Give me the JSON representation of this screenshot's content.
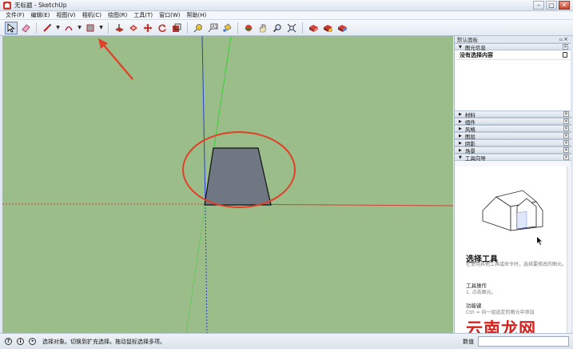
{
  "window": {
    "title": "无标题 - SketchUp",
    "controls": [
      "minimize",
      "maximize",
      "close"
    ]
  },
  "menu": {
    "items": [
      "文件(F)",
      "编辑(E)",
      "视图(V)",
      "相机(C)",
      "绘图(R)",
      "工具(T)",
      "窗口(W)",
      "帮助(H)"
    ]
  },
  "toolbar": {
    "icons": [
      "select-icon",
      "eraser-icon",
      "pencil-line-icon",
      "arc-icon",
      "rectangle-icon",
      "push-pull-icon",
      "offset-icon",
      "move-icon",
      "rotate-icon",
      "scale-icon",
      "tape-measure-icon",
      "text-icon",
      "paint-bucket-icon",
      "orbit-icon",
      "pan-icon",
      "zoom-icon",
      "zoom-extents-icon",
      "warehouse-icon",
      "extension-icon",
      "share-icon"
    ]
  },
  "tray": {
    "title": "默认面板",
    "entity_info": {
      "header": "图元信息",
      "value": "没有选择内容"
    },
    "sections": [
      "材料",
      "组件",
      "风格",
      "图层",
      "阴影",
      "场景"
    ],
    "instructor": {
      "header": "工具向导",
      "tool_title": "选择工具",
      "tool_desc": "在使用其他工具或命令时，选择要修改的图元。",
      "ops_heading": "工具操作",
      "ops_text": "1. 点击图元。",
      "keys_heading": "功能键",
      "keys_text": "Ctrl = 向一组选定的图元中添加"
    }
  },
  "status": {
    "message": "选择对象。切换到扩充选择。拖动鼠标选择多项。",
    "measure_label": "数值",
    "measure_value": ""
  },
  "watermark": "云南龙网",
  "colors": {
    "viewport_bg": "#9bbd89",
    "shape_fill": "#6f7782",
    "red_axis": "#d2413a",
    "green_axis": "#3ccf3c",
    "blue_axis": "#2a3fd6",
    "annotation": "#e0402a"
  }
}
